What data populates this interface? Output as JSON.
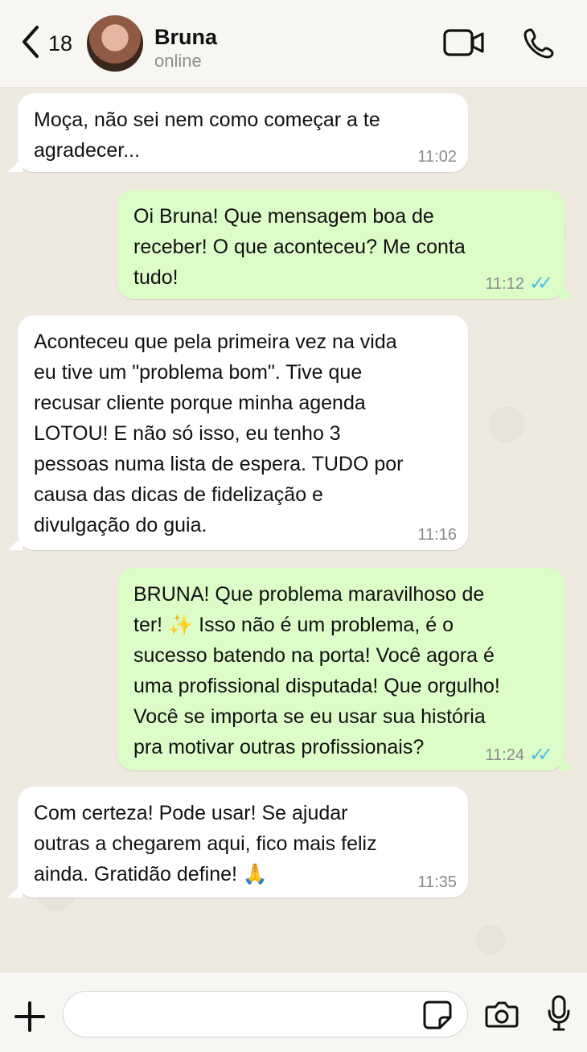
{
  "header": {
    "back_count": "18",
    "name": "Bruna",
    "status": "online"
  },
  "messages": [
    {
      "direction": "in",
      "text": "Moça, não sei nem como começar a te\nagradecer...",
      "time": "11:02"
    },
    {
      "direction": "out",
      "text": "Oi Bruna! Que mensagem boa de\nreceber! O que aconteceu? Me conta\ntudo!",
      "time": "11:12",
      "status_icon": "double-check-icon"
    },
    {
      "direction": "in",
      "text": "Aconteceu que pela primeira vez na vida\neu tive um \"problema bom\". Tive que\nrecusar cliente porque minha agenda\nLOTOU! E não só isso, eu tenho 3\npessoas numa lista de espera. TUDO por\ncausa das dicas de fidelização e\ndivulgação do guia.",
      "time": "11:16"
    },
    {
      "direction": "out",
      "text": "BRUNA! Que problema maravilhoso de\nter! ✨ Isso não é um problema, é o\nsucesso batendo na porta! Você agora é\numa profissional disputada! Que orgulho!\nVocê se importa se eu usar sua história\npra motivar outras profissionais?",
      "time": "11:24",
      "status_icon": "double-check-icon"
    },
    {
      "direction": "in",
      "text": "Com certeza! Pode usar! Se ajudar\noutras a chegarem aqui, fico mais feliz\nainda. Gratidão define! 🙏",
      "time": "11:35"
    }
  ],
  "composer": {
    "placeholder": ""
  },
  "icons": {
    "back": "chevron-left-icon",
    "video": "video-camera-icon",
    "call": "phone-icon",
    "plus": "plus-icon",
    "sticker": "sticker-icon",
    "camera": "camera-icon",
    "mic": "microphone-icon"
  },
  "colors": {
    "incoming_bubble": "#ffffff",
    "outgoing_bubble": "#dcfcc8",
    "read_ticks": "#53bdeb",
    "chat_background": "#efeae0"
  }
}
